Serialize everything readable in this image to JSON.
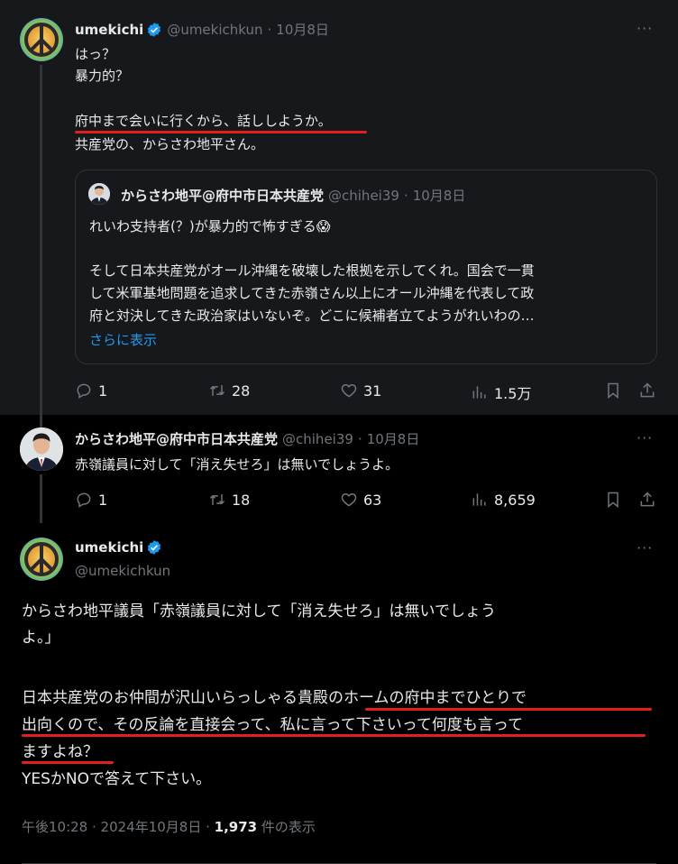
{
  "tweet1": {
    "name": "umekichi",
    "handle": "@umekichkun",
    "sep": "·",
    "date": "10月8日",
    "more": "···",
    "lines": [
      "はっ？",
      "暴力的？",
      "",
      "府中まで会いに行くから、話ししようか。",
      "共産党の、からさわ地平さん。"
    ],
    "quote": {
      "name": "からさわ地平@府中市日本共産党",
      "handle": "@chihei39",
      "sep": "·",
      "date": "10月8日",
      "lines": [
        "れいわ支持者(？)が暴力的で怖すぎる😱",
        "",
        "そして日本共産党がオール沖縄を破壊した根拠を示してくれ。国会で一貫",
        "して米軍基地問題を追求してきた赤嶺さん以上にオール沖縄を代表して政",
        "府と対決してきた政治家はいないぞ。どこに候補者立てようがれいわの…"
      ],
      "show_more": "さらに表示"
    },
    "actions": {
      "reply": "1",
      "repost": "28",
      "like": "31",
      "views": "1.5万"
    }
  },
  "tweet2": {
    "name": "からさわ地平@府中市日本共産党",
    "handle": "@chihei39",
    "sep": "·",
    "date": "10月8日",
    "more": "···",
    "text": "赤嶺議員に対して「消え失せろ」は無いでしょうよ。",
    "actions": {
      "reply": "1",
      "repost": "18",
      "like": "63",
      "views": "8,659"
    }
  },
  "tweet3": {
    "name": "umekichi",
    "handle": "@umekichkun",
    "more": "···",
    "lines": [
      "からさわ地平議員「赤嶺議員に対して「消え失せろ」は無いでしょう",
      "よ。」",
      "",
      "日本共産党のお仲間が沢山いらっしゃる貴殿のホームの府中までひとりで",
      "出向くので、その反論を直接会って、私に言って下さいって何度も言って",
      "ますよね？",
      "YESかNOで答えて下さい。"
    ],
    "meta_time": "午後10:28 · 2024年10月8日 · ",
    "meta_views": "1,973",
    "meta_suffix": " 件の表示"
  },
  "colors": {
    "accent": "#1d9bf0",
    "verified": "#1d9bf0",
    "underline": "#e0201c",
    "muted": "#71767b"
  }
}
